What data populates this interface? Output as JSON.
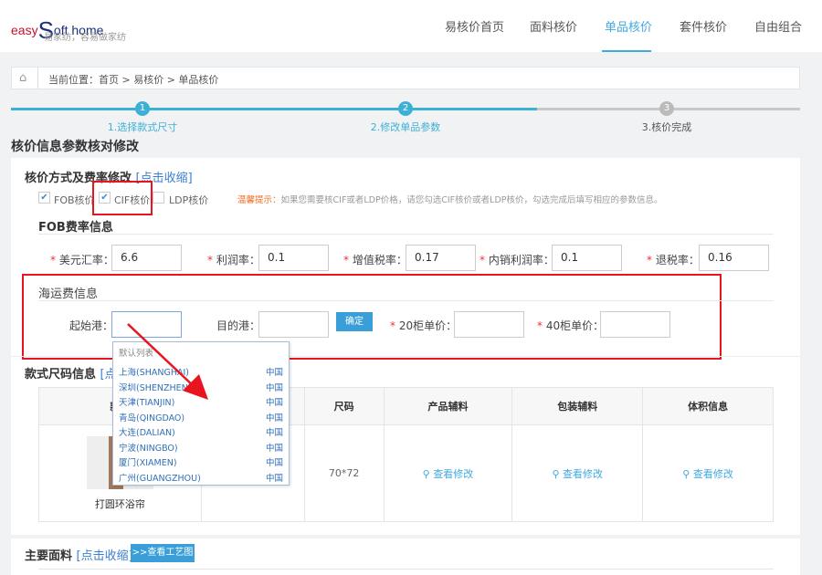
{
  "logo": {
    "en_easy": "easy",
    "en_s": "S",
    "en_rest": "oft home",
    "tagline": "易家纺，容易做家纺"
  },
  "nav": [
    {
      "label": "易核价首页",
      "active": false
    },
    {
      "label": "面料核价",
      "active": false
    },
    {
      "label": "单品核价",
      "active": true
    },
    {
      "label": "套件核价",
      "active": false
    },
    {
      "label": "自由组合",
      "active": false
    }
  ],
  "breadcrumb": {
    "icon": "home-icon",
    "text": "当前位置：首页 > 易核价 > 单品核价"
  },
  "steps": [
    {
      "num": "1",
      "label": "1.选择款式尺寸",
      "state": "done"
    },
    {
      "num": "2",
      "label": "2.修改单品参数",
      "state": "current"
    },
    {
      "num": "3",
      "label": "3.核价完成",
      "state": "pending"
    }
  ],
  "page_title": "核价信息参数核对修改",
  "pricing": {
    "heading": "核价方式及费率修改",
    "toggle": "[点击收缩]",
    "options": [
      {
        "label": "FOB核价",
        "checked": true
      },
      {
        "label": "CIF核价",
        "checked": true
      },
      {
        "label": "LDP核价",
        "checked": false
      }
    ],
    "tip_label": "温馨提示：",
    "tip": "如果您需要核CIF或者LDP价格，请您勾选CIF核价或者LDP核价，勾选完成后填写相应的参数信息。"
  },
  "fob": {
    "heading": "FOB费率信息",
    "fields": [
      {
        "label": "美元汇率：",
        "value": "6.6"
      },
      {
        "label": "利润率：",
        "value": "0.1"
      },
      {
        "label": "增值税率：",
        "value": "0.17"
      },
      {
        "label": "内销利润率：",
        "value": "0.1"
      },
      {
        "label": "退税率：",
        "value": "0.16"
      }
    ]
  },
  "shipping": {
    "heading": "海运费信息",
    "origin_label": "起始港：",
    "origin_value": "",
    "dest_label": "目的港：",
    "dest_value": "",
    "confirm": "确定",
    "c20_label": "20柜单价：",
    "c20_value": "",
    "c40_label": "40柜单价：",
    "c40_value": ""
  },
  "dropdown": {
    "title": "默认列表",
    "items": [
      {
        "port": "上海(SHANGHAI)",
        "country": "中国"
      },
      {
        "port": "深圳(SHENZHEN)",
        "country": "中国"
      },
      {
        "port": "天津(TIANJIN)",
        "country": "中国"
      },
      {
        "port": "青岛(QINGDAO)",
        "country": "中国"
      },
      {
        "port": "大连(DALIAN)",
        "country": "中国"
      },
      {
        "port": "宁波(NINGBO)",
        "country": "中国"
      },
      {
        "port": "厦门(XIAMEN)",
        "country": "中国"
      },
      {
        "port": "广州(GUANGZHOU)",
        "country": "中国"
      }
    ]
  },
  "style": {
    "heading": "款式尺码信息",
    "toggle": "[点击收缩]",
    "columns": [
      "款式",
      "",
      "尺码",
      "产品辅料",
      "包装辅料",
      "体积信息"
    ],
    "row": {
      "name": "打圆环浴帘",
      "size": "70*72",
      "view": "查看修改"
    }
  },
  "fabric": {
    "heading": "主要面料",
    "toggle": "[点击收缩]",
    "button": ">>查看工艺图"
  },
  "colors": {
    "accent": "#3fa9e0",
    "highlight": "#e8141e",
    "required": "#ee3333"
  }
}
